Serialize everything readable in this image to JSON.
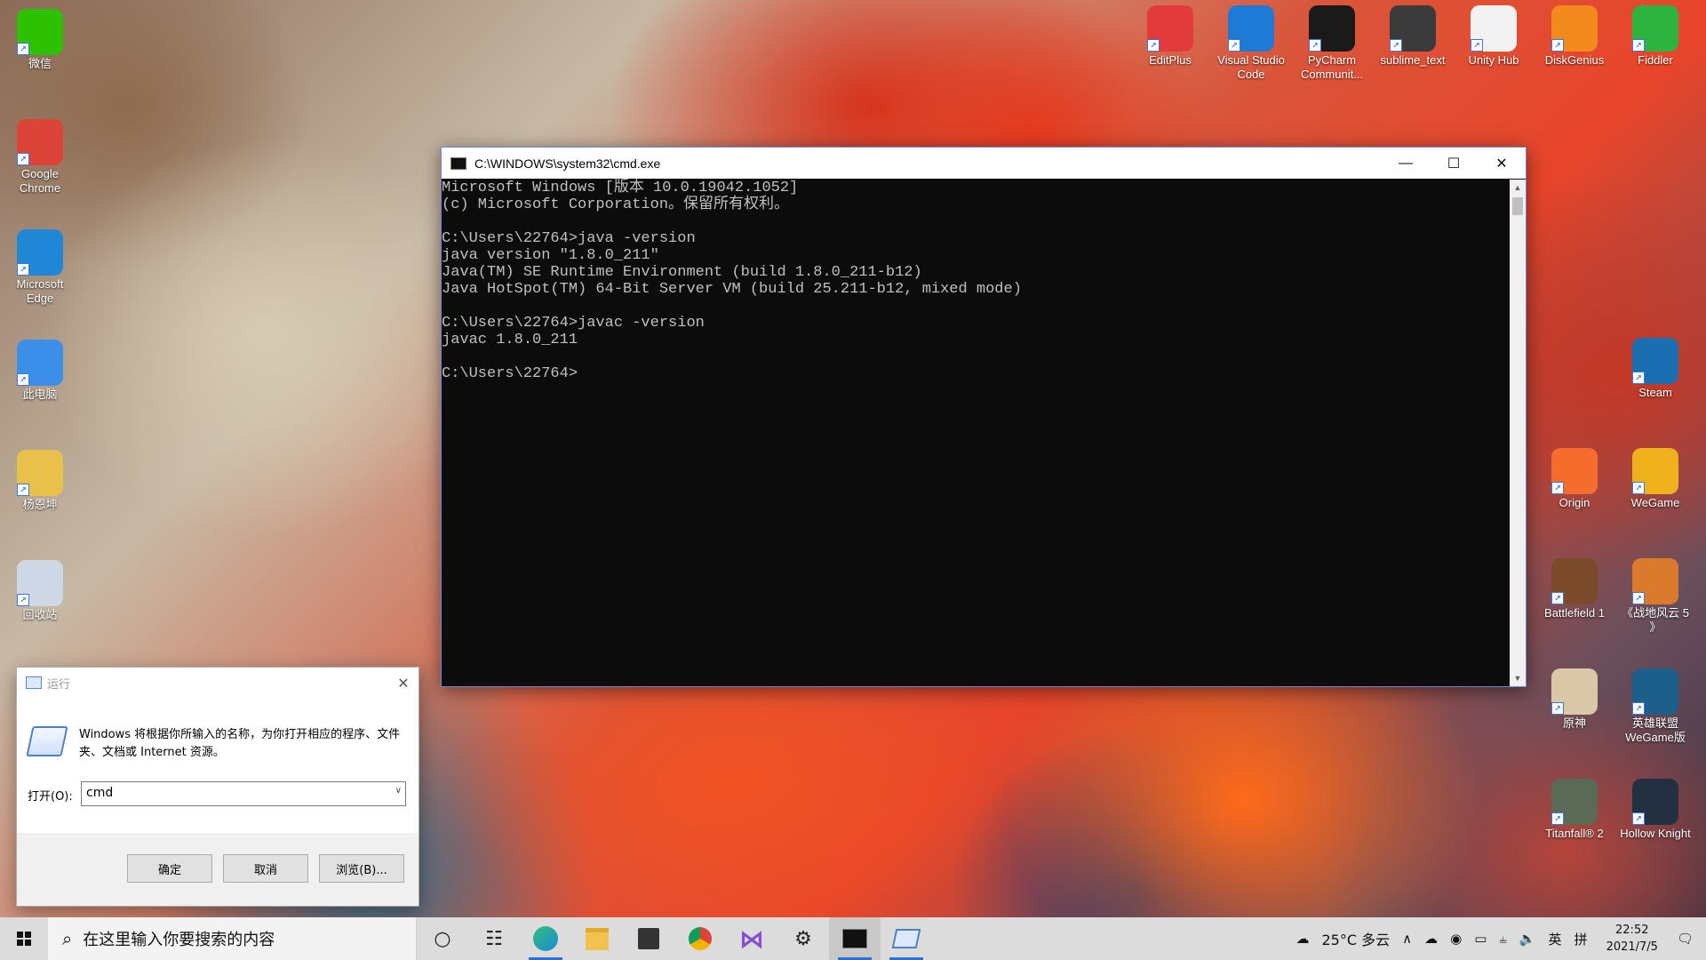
{
  "desktop": {
    "left_icons": [
      {
        "label": "微信",
        "icon": "wechat-icon",
        "color": "#2dc100"
      },
      {
        "label": "Google Chrome",
        "icon": "chrome-icon",
        "color": "#db4437"
      },
      {
        "label": "Microsoft Edge",
        "icon": "edge-icon",
        "color": "#1e88d6"
      },
      {
        "label": "此电脑",
        "icon": "computer-icon",
        "color": "#3b8fe8"
      },
      {
        "label": "杨恩坤",
        "icon": "user-folder-icon",
        "color": "#e8c04a"
      },
      {
        "label": "回收站",
        "icon": "recycle-bin-icon",
        "color": "#cfd8e6"
      }
    ],
    "top_icons": [
      {
        "label": "EditPlus",
        "icon": "editplus-icon",
        "color": "#e23b3b"
      },
      {
        "label": "Visual Studio Code",
        "icon": "vscode-icon",
        "color": "#1f7ad6"
      },
      {
        "label": "PyCharm Communit...",
        "icon": "pycharm-icon",
        "color": "#1a1a1a"
      },
      {
        "label": "sublime_text",
        "icon": "sublime-icon",
        "color": "#3b3b3b"
      },
      {
        "label": "Unity Hub",
        "icon": "unity-icon",
        "color": "#f2f2f2"
      },
      {
        "label": "DiskGenius",
        "icon": "diskgenius-icon",
        "color": "#f28a1e"
      },
      {
        "label": "Fiddler",
        "icon": "fiddler-icon",
        "color": "#2db33f"
      }
    ],
    "right_icons": [
      {
        "label": "Steam",
        "icon": "steam-icon",
        "color": "#1b6fb0"
      },
      {
        "label": "Origin",
        "icon": "origin-icon",
        "color": "#f56c2d"
      },
      {
        "label": "WeGame",
        "icon": "wegame-icon",
        "color": "#f0b21c"
      },
      {
        "label": "Battlefield 1",
        "icon": "battlefield1-icon",
        "color": "#7a4a2a"
      },
      {
        "label": "《战地风云 5 》",
        "icon": "battlefield5-icon",
        "color": "#d97a2d"
      },
      {
        "label": "原神",
        "icon": "genshin-icon",
        "color": "#d9c7a8"
      },
      {
        "label": "英雄联盟 WeGame版",
        "icon": "lol-icon",
        "color": "#1c5f8a"
      },
      {
        "label": "Titanfall® 2",
        "icon": "titanfall-icon",
        "color": "#5b6a56"
      },
      {
        "label": "Hollow Knight",
        "icon": "hollow-knight-icon",
        "color": "#223041"
      }
    ]
  },
  "cmd": {
    "title": "C:\\WINDOWS\\system32\\cmd.exe",
    "lines": [
      "Microsoft Windows [版本 10.0.19042.1052]",
      "(c) Microsoft Corporation。保留所有权利。",
      "",
      "C:\\Users\\22764>java -version",
      "java version \"1.8.0_211\"",
      "Java(TM) SE Runtime Environment (build 1.8.0_211-b12)",
      "Java HotSpot(TM) 64-Bit Server VM (build 25.211-b12, mixed mode)",
      "",
      "C:\\Users\\22764>javac -version",
      "javac 1.8.0_211",
      "",
      "C:\\Users\\22764>"
    ]
  },
  "run": {
    "title": "运行",
    "description": "Windows 将根据你所输入的名称，为你打开相应的程序、文件夹、文档或 Internet 资源。",
    "open_label": "打开(O):",
    "input_value": "cmd",
    "ok": "确定",
    "cancel": "取消",
    "browse": "浏览(B)..."
  },
  "taskbar": {
    "search_placeholder": "在这里输入你要搜索的内容",
    "weather": "25°C 多云",
    "lang1": "英",
    "lang2": "拼",
    "time": "22:52",
    "date": "2021/7/5"
  }
}
